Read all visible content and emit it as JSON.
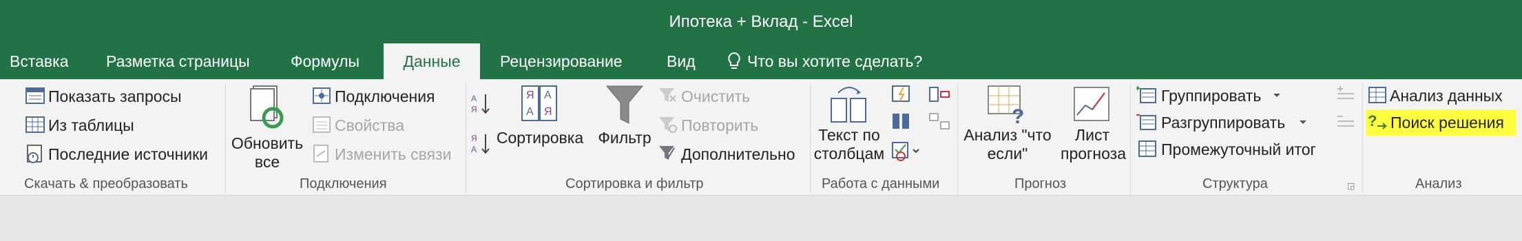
{
  "window": {
    "title": "Ипотека + Вклад - Excel"
  },
  "tabs": [
    {
      "label": "Вставка"
    },
    {
      "label": "Разметка страницы"
    },
    {
      "label": "Формулы"
    },
    {
      "label": "Данные"
    },
    {
      "label": "Рецензирование"
    },
    {
      "label": "Вид"
    }
  ],
  "tell_me": "Что вы хотите сделать?",
  "groups": {
    "get_transform": {
      "label": "Скачать & преобразовать",
      "show_queries": "Показать запросы",
      "from_table": "Из таблицы",
      "recent_sources": "Последние источники"
    },
    "connections": {
      "label": "Подключения",
      "refresh_line1": "Обновить",
      "refresh_line2": "все",
      "connections": "Подключения",
      "properties": "Свойства",
      "edit_links": "Изменить связи"
    },
    "sort_filter": {
      "label": "Сортировка и фильтр",
      "sort": "Сортировка",
      "filter": "Фильтр",
      "clear": "Очистить",
      "reapply": "Повторить",
      "advanced": "Дополнительно"
    },
    "data_tools": {
      "label": "Работа с данными",
      "text_to_columns_line1": "Текст по",
      "text_to_columns_line2": "столбцам"
    },
    "forecast": {
      "label": "Прогноз",
      "what_if_line1": "Анализ \"что",
      "what_if_line2": "если\"",
      "forecast_sheet_line1": "Лист",
      "forecast_sheet_line2": "прогноза"
    },
    "outline": {
      "label": "Структура",
      "group": "Группировать",
      "ungroup": "Разгруппировать",
      "subtotal": "Промежуточный итог"
    },
    "analysis": {
      "label": "Анализ",
      "data_analysis": "Анализ данных",
      "solver": "Поиск решения"
    }
  },
  "colors": {
    "excel_green": "#217346",
    "highlight": "#ffff40"
  }
}
